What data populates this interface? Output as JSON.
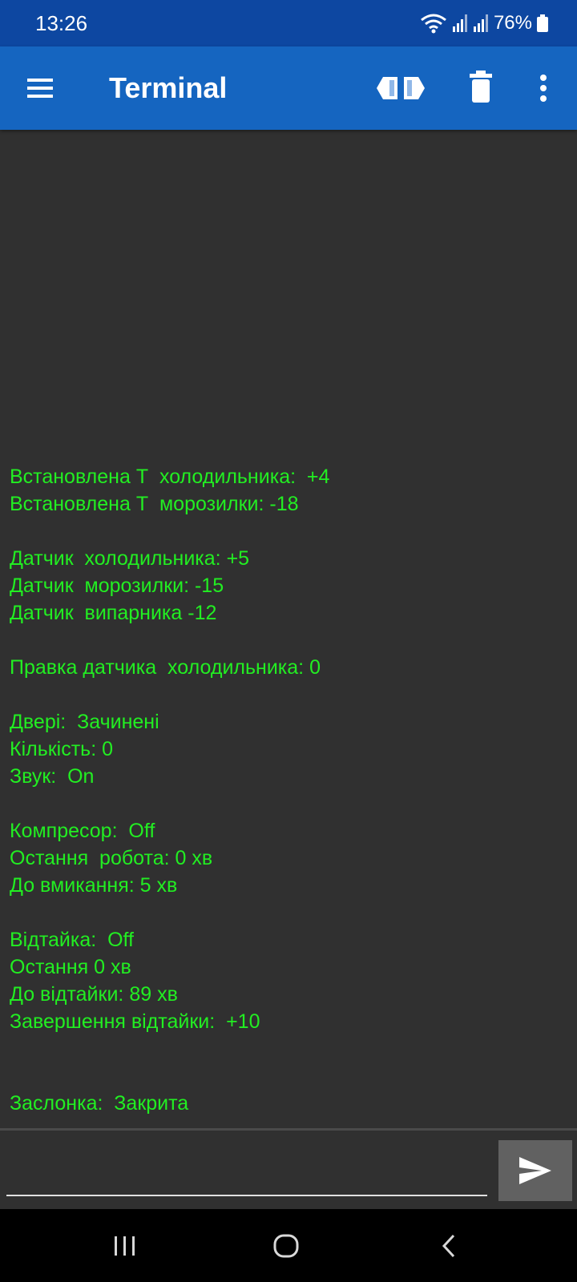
{
  "status_bar": {
    "time": "13:26",
    "battery_percent": "76%",
    "icons": [
      "wifi-icon",
      "signal-icon",
      "signal-icon",
      "battery-icon"
    ]
  },
  "app_bar": {
    "title": "Terminal",
    "actions": [
      "connect-icon",
      "delete-icon",
      "more-vert-icon"
    ]
  },
  "terminal": {
    "lines": [
      "Встановлена Т  холодильника:  +4",
      "Встановлена Т  морозилки: -18",
      "",
      "Датчик  холодильника: +5",
      "Датчик  морозилки: -15",
      "Датчик  випарника -12",
      "",
      "Правка датчика  холодильника: 0",
      "",
      "Двері:  Зачинені",
      "Кількість: 0",
      "Звук:  On",
      "",
      "Компресор:  Off",
      "Остання  робота: 0 хв",
      "До вмикання: 5 хв",
      "",
      "Відтайка:  Off",
      "Остання 0 хв",
      "До відтайки: 89 хв",
      "Завершення відтайки:  +10",
      "",
      "",
      "Заслонка:  Закрита"
    ],
    "text_color": "#22ee22",
    "background": "#303030"
  },
  "input": {
    "value": "",
    "placeholder": ""
  },
  "colors": {
    "status_bar": "#0d47a1",
    "app_bar": "#1565c0",
    "send_button": "#616161"
  }
}
